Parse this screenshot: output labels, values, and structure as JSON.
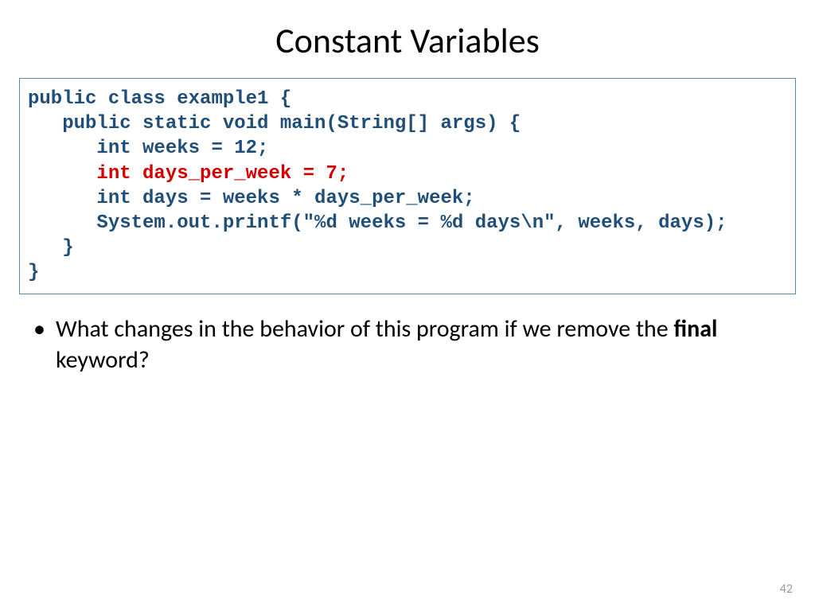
{
  "title": "Constant Variables",
  "code": {
    "line1": "public class example1 {",
    "line2": "   public static void main(String[] args) {",
    "line3": "      int weeks = 12;",
    "line4": "      int days_per_week = 7;",
    "line5": "      int days = weeks * days_per_week;",
    "line6": "      System.out.printf(\"%d weeks = %d days\\n\", weeks, days);",
    "line7": "   }",
    "line8": "}"
  },
  "bullet": {
    "dot": "•",
    "pre": "What changes in the behavior of this program if we remove the ",
    "bold": "final",
    "post": " keyword?"
  },
  "page_number": "42"
}
